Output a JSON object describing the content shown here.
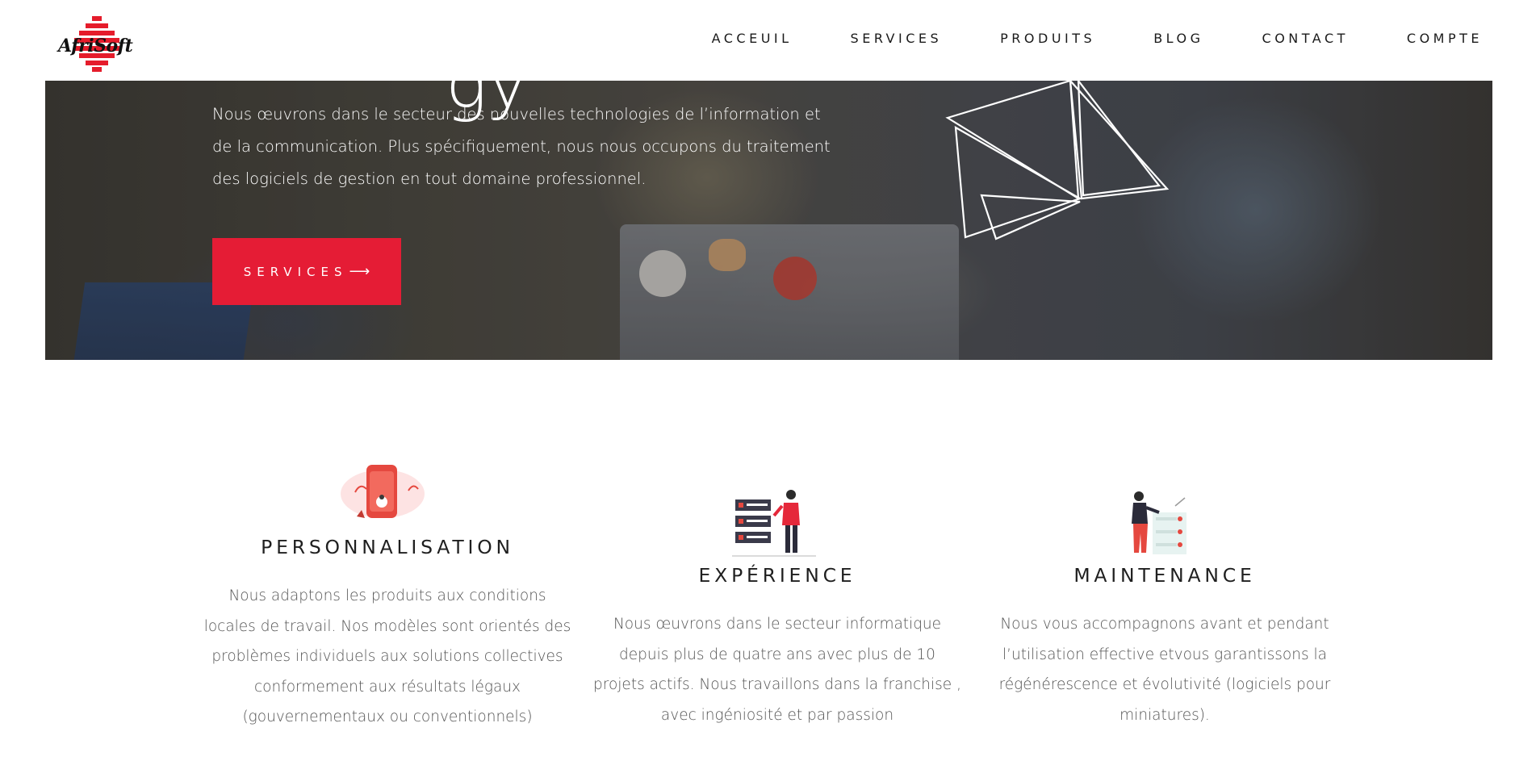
{
  "logo": {
    "text": "AfriSoft"
  },
  "nav": {
    "items": [
      {
        "label": "ACCEUIL"
      },
      {
        "label": "SERVICES"
      },
      {
        "label": "PRODUITS"
      },
      {
        "label": "BLOG"
      },
      {
        "label": "CONTACT"
      },
      {
        "label": "COMPTE"
      }
    ]
  },
  "hero": {
    "title_fragment": "gy",
    "intro": "Nous œuvrons dans le secteur des nouvelles technologies de l’information et de la communication. Plus spécifiquement, nous nous occupons du traitement des logiciels de gestion en tout domaine professionnel.",
    "cta_label": "SERVICES",
    "cta_arrow": "⟶"
  },
  "features": [
    {
      "title": "PERSONNALISATION",
      "text": "Nous adaptons les produits aux conditions locales de travail. Nos modèles sont orientés des problèmes individuels aux solutions collectives conformement aux résultats légaux (gouvernementaux ou conventionnels)"
    },
    {
      "title": "EXPÉRIENCE",
      "text": "Nous œuvrons dans le secteur informatique depuis plus de quatre ans avec plus de 10 projets actifs. Nous travaillons dans la franchise , avec ingéniosité et par passion"
    },
    {
      "title": "MAINTENANCE",
      "text": "Nous vous accompagnons avant et pendant l’utilisation effective etvous garantissons la régénérescence et évolutivité (logiciels pour miniatures)."
    }
  ],
  "colors": {
    "accent": "#e51c35",
    "heading": "#1f1f1f",
    "body_text": "#555555"
  }
}
